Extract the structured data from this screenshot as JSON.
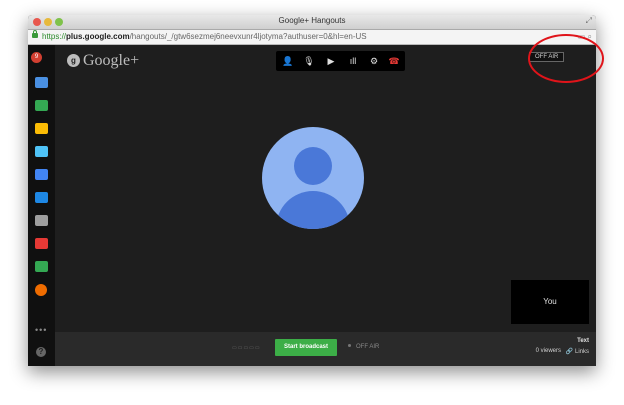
{
  "window": {
    "title": "Google+ Hangouts"
  },
  "url": {
    "scheme": "https://",
    "host": "plus.google.com",
    "path": "/hangouts/_/gtw6sezmej6neevxunr4ljotyma?authuser=0&hl=en-US"
  },
  "brand": {
    "logo_text": "Google+",
    "logo_icon": "g"
  },
  "sidebar": {
    "apps": [
      {
        "name": "chat-app-icon",
        "color": "#4a90e2"
      },
      {
        "name": "screenshare-app-icon",
        "color": "#34a853"
      },
      {
        "name": "tag-app-icon",
        "color": "#fbbc05"
      },
      {
        "name": "qa-app-icon",
        "color": "#4fc3f7"
      },
      {
        "name": "camera-app-icon",
        "color": "#4285f4"
      },
      {
        "name": "video-app-icon",
        "color": "#1e88e5"
      },
      {
        "name": "film-app-icon",
        "color": "#9e9e9e"
      },
      {
        "name": "youtube-app-icon",
        "color": "#e53935"
      },
      {
        "name": "drive-app-icon",
        "color": "#34a853"
      },
      {
        "name": "help-ring-app-icon",
        "color": "#ef6c00"
      }
    ],
    "notification_count": "9",
    "more": "•••",
    "help": "?"
  },
  "colors": {
    "accent_red": "#e0141a",
    "broadcast_green": "#3cae47"
  },
  "status": {
    "top_badge": "OFF AIR",
    "bottom_badge": "OFF AIR"
  },
  "actions": {
    "start_broadcast": "Start broadcast"
  },
  "self_view": {
    "label": "You"
  },
  "footer": {
    "text_label": "Text",
    "viewers": "0 viewers",
    "links": "Links"
  }
}
